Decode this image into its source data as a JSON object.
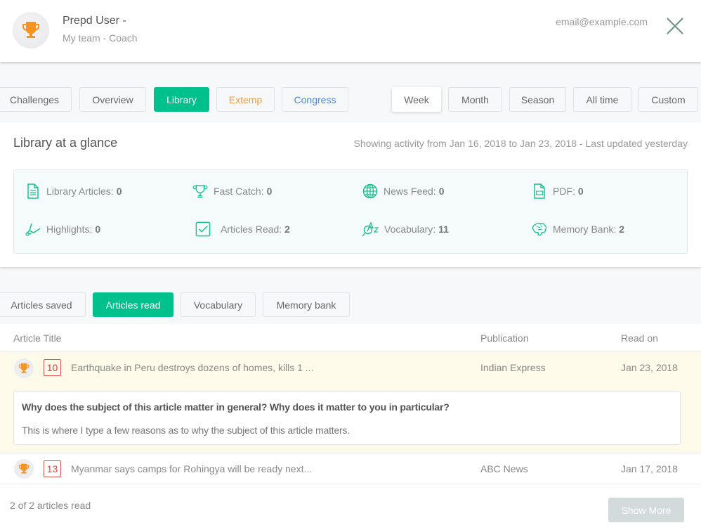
{
  "header": {
    "user_name": "Prepd User -",
    "user_role": "My team - Coach",
    "email": "email@example.com",
    "avatar_icon": "trophy-icon",
    "close_icon": "close-icon"
  },
  "nav": {
    "section_tabs": [
      {
        "label": "Challenges",
        "active": false
      },
      {
        "label": "Overview",
        "active": false
      },
      {
        "label": "Library",
        "active": true
      },
      {
        "label": "Extemp",
        "active": false
      },
      {
        "label": "Congress",
        "active": false
      }
    ],
    "period_tabs": [
      {
        "label": "Week",
        "active": true
      },
      {
        "label": "Month",
        "active": false
      },
      {
        "label": "Season",
        "active": false
      },
      {
        "label": "All time",
        "active": false
      },
      {
        "label": "Custom",
        "active": false
      }
    ]
  },
  "glance": {
    "title": "Library at a glance",
    "range_text": "Showing activity from Jan 16, 2018 to Jan 23, 2018 - Last updated yesterday",
    "stats": [
      {
        "label": "Library Articles:",
        "value": "0",
        "icon": "document-icon"
      },
      {
        "label": "Fast Catch:",
        "value": "0",
        "icon": "trophy-icon"
      },
      {
        "label": "News Feed:",
        "value": "0",
        "icon": "globe-icon"
      },
      {
        "label": "PDF:",
        "value": "0",
        "icon": "pdf-icon"
      },
      {
        "label": "Highlights:",
        "value": "0",
        "icon": "highlighter-icon"
      },
      {
        "label": "Articles Read:",
        "value": "2",
        "icon": "checkbox-icon"
      },
      {
        "label": "Vocabulary:",
        "value": "11",
        "icon": "vocabulary-icon"
      },
      {
        "label": "Memory Bank:",
        "value": "2",
        "icon": "brain-icon"
      }
    ]
  },
  "sub_tabs": [
    {
      "label": "Articles saved",
      "active": false
    },
    {
      "label": "Articles read",
      "active": true
    },
    {
      "label": "Vocabulary",
      "active": false
    },
    {
      "label": "Memory bank",
      "active": false
    }
  ],
  "table": {
    "columns": [
      "Article Title",
      "Publication",
      "Read on"
    ],
    "rows": [
      {
        "score": "10",
        "title": "Earthquake in Peru destroys dozens of homes, kills 1 ...",
        "publication": "Indian Express",
        "read_on": "Jan 23, 2018",
        "expanded": true,
        "question": "Why does the subject of this article matter in general? Why does it matter to you in particular?",
        "answer": "This is where I type a few reasons as to why the subject of this article matters."
      },
      {
        "score": "13",
        "title": "Myanmar says camps for Rohingya will be ready next...",
        "publication": "ABC News",
        "read_on": "Jan 17, 2018",
        "expanded": false
      }
    ]
  },
  "footer": {
    "count_text": "2 of 2 articles read",
    "show_more_label": "Show More"
  },
  "colors": {
    "accent": "#00c08b",
    "trophy": "#f7931e",
    "extemp": "#f59a3c",
    "congress": "#4d86d8",
    "score_border": "#d9534f",
    "expanded_row_bg": "#fefaea"
  }
}
